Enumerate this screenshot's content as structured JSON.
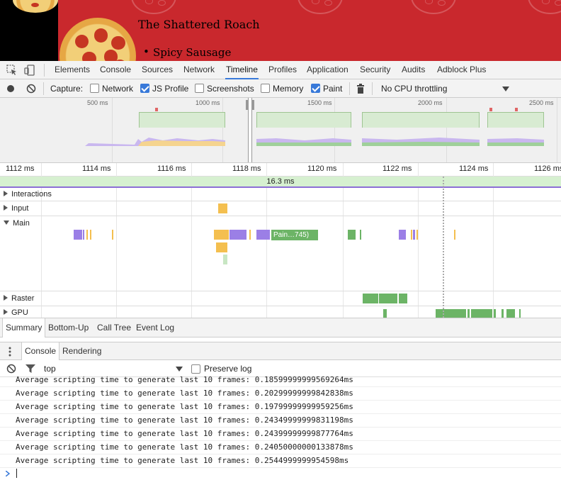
{
  "page": {
    "title": "The Shattered Roach",
    "list_items": [
      "Spicy Sausage"
    ]
  },
  "devtools": {
    "tabs": [
      "Elements",
      "Console",
      "Sources",
      "Network",
      "Timeline",
      "Profiles",
      "Application",
      "Security",
      "Audits",
      "Adblock Plus"
    ],
    "active_tab": "Timeline",
    "toolbar": {
      "capture_label": "Capture:",
      "options": [
        {
          "label": "Network",
          "checked": false
        },
        {
          "label": "JS Profile",
          "checked": true
        },
        {
          "label": "Screenshots",
          "checked": false
        },
        {
          "label": "Memory",
          "checked": false
        },
        {
          "label": "Paint",
          "checked": true
        }
      ],
      "cpu_throttling": "No CPU throttling"
    },
    "overview_ticks": [
      "500 ms",
      "1000 ms",
      "1500 ms",
      "2000 ms",
      "2500 ms"
    ],
    "ruler_ticks": [
      "1112 ms",
      "1114 ms",
      "1116 ms",
      "1118 ms",
      "1120 ms",
      "1122 ms",
      "1124 ms",
      "1126 ms"
    ],
    "frame_duration": "16.3 ms",
    "tracks": {
      "interactions": "Interactions",
      "input": "Input",
      "main": "Main",
      "raster": "Raster",
      "gpu": "GPU"
    },
    "paint_event_label": "Pain…745)",
    "bottom_tabs": [
      "Summary",
      "Bottom-Up",
      "Call Tree",
      "Event Log"
    ],
    "active_bottom_tab": "Summary",
    "drawer_tabs": [
      "Console",
      "Rendering"
    ],
    "active_drawer_tab": "Console",
    "console_filter": {
      "context": "top",
      "preserve_log_label": "Preserve log",
      "preserve_log_checked": false
    },
    "console_lines": [
      "Average scripting time to generate last 10 frames: 0.18599999999569264ms",
      "Average scripting time to generate last 10 frames: 0.20299999999842838ms",
      "Average scripting time to generate last 10 frames: 0.19799999999959256ms",
      "Average scripting time to generate last 10 frames: 0.24349999999831198ms",
      "Average scripting time to generate last 10 frames: 0.24399999999877764ms",
      "Average scripting time to generate last 10 frames: 0.24050000000133878ms",
      "Average scripting time to generate last 10 frames: 0.2544999999954598ms"
    ],
    "colors": {
      "scripting": "#f4bf4f",
      "rendering": "#9b7fe6",
      "painting": "#6cb466",
      "accent": "#3879d9"
    }
  }
}
